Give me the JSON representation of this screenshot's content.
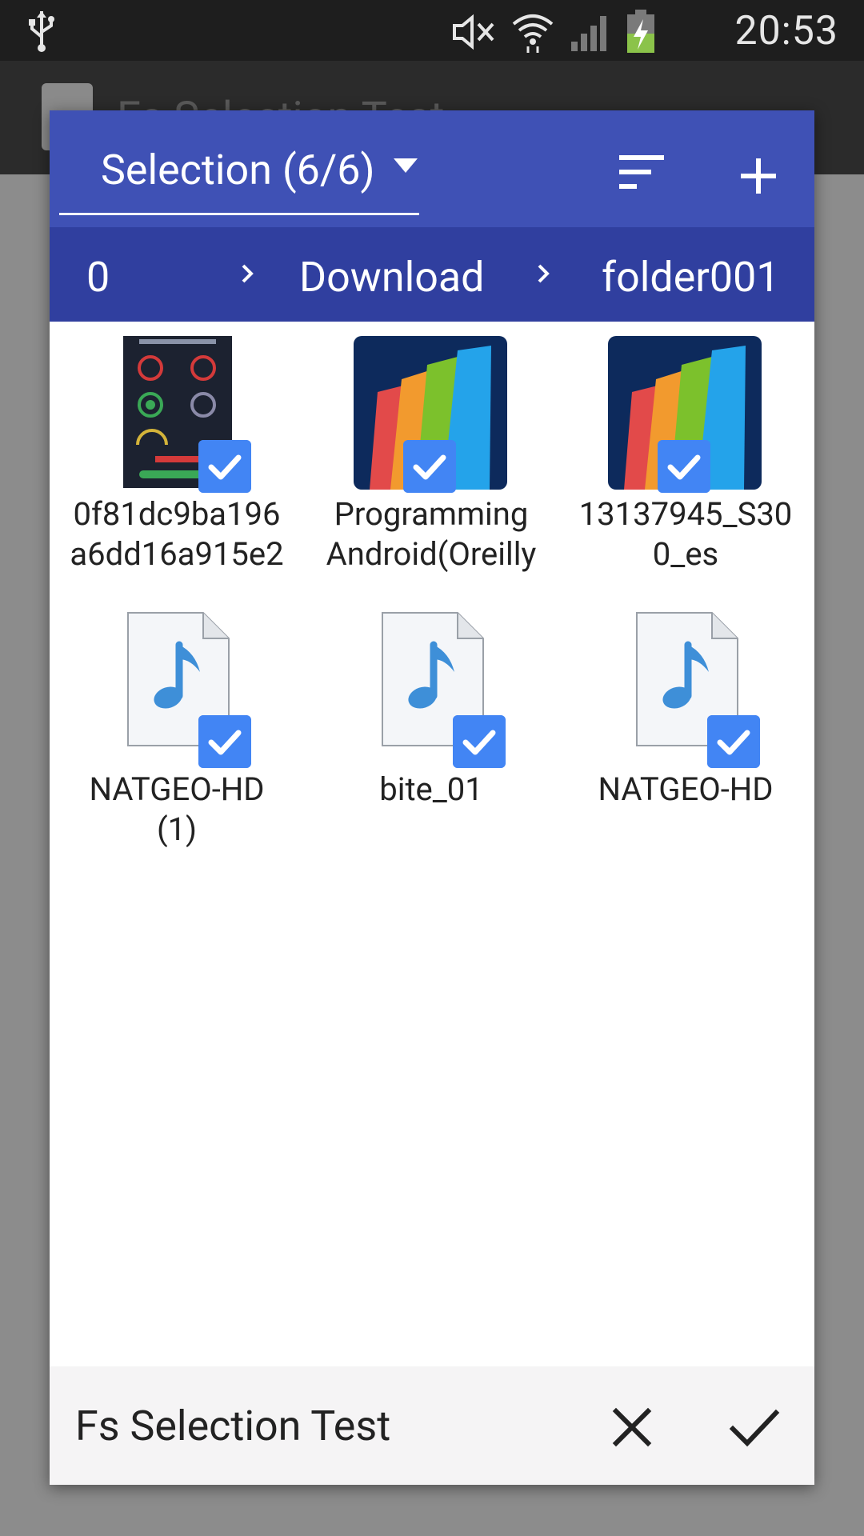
{
  "status_bar": {
    "time": "20:53",
    "icons": [
      "usb-icon",
      "mute-icon",
      "wifi-icon",
      "signal-icon",
      "battery-charging-icon"
    ]
  },
  "background_app": {
    "title": "Fs Selection Test"
  },
  "dialog": {
    "header": {
      "selection_label": "Selection (6/6)",
      "icons": [
        "dropdown-caret-icon",
        "sort-icon",
        "add-icon"
      ]
    },
    "breadcrumb": [
      "0",
      "Download",
      "folder001"
    ],
    "files": [
      {
        "name_line1": "0f81dc9ba196",
        "name_line2": "a6dd16a915e2",
        "type": "image",
        "selected": true
      },
      {
        "name_line1": "Programming",
        "name_line2": "Android(Oreilly",
        "type": "document",
        "selected": true
      },
      {
        "name_line1": "13137945_S30",
        "name_line2": "0_es",
        "type": "document",
        "selected": true
      },
      {
        "name_line1": "NATGEO-HD",
        "name_line2": "(1)",
        "type": "audio",
        "selected": true
      },
      {
        "name_line1": "bite_01",
        "name_line2": "",
        "type": "audio",
        "selected": true
      },
      {
        "name_line1": "NATGEO-HD",
        "name_line2": "",
        "type": "audio",
        "selected": true
      }
    ],
    "footer": {
      "title": "Fs Selection Test",
      "icons": [
        "close-icon",
        "check-icon"
      ]
    }
  },
  "colors": {
    "header": "#3f51b5",
    "breadcrumb": "#303f9f",
    "check_badge": "#4285f4",
    "audio_note": "#3e8fd8"
  }
}
